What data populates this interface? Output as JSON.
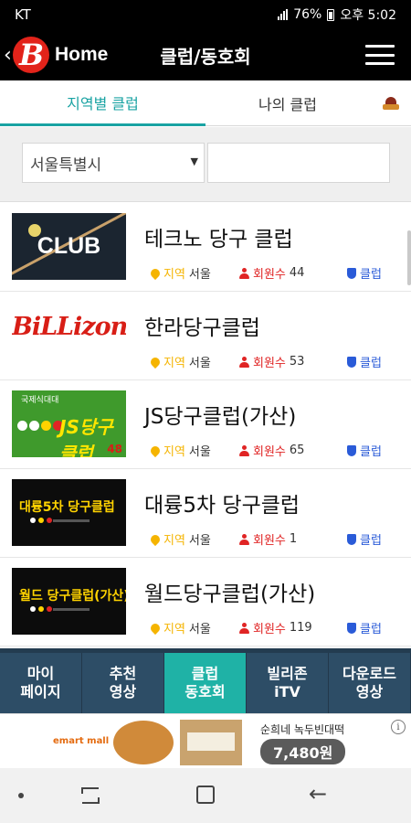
{
  "status_bar": {
    "carrier": "KT",
    "battery": "76%",
    "time": "오후 5:02"
  },
  "header": {
    "home_label": "Home",
    "title": "클럽/동호회",
    "logo_letter": "B"
  },
  "tabs": [
    {
      "label": "지역별 클럽",
      "active": true
    },
    {
      "label": "나의 클럽",
      "active": false
    }
  ],
  "filter": {
    "region_value": "서울특별시",
    "search_value": ""
  },
  "meta_labels": {
    "region": "지역",
    "members": "회원수",
    "club": "클럽"
  },
  "clubs": [
    {
      "name": "테크노 당구 클럽",
      "region": "서울",
      "members": "44",
      "thumb_text": "CLUB"
    },
    {
      "name": "한라당구클럽",
      "region": "서울",
      "members": "53",
      "thumb_text": "BiLLizone"
    },
    {
      "name": "JS당구클럽(가산)",
      "region": "서울",
      "members": "65",
      "thumb_text": "JS당구클럽",
      "thumb_top": "국제식대대",
      "thumb_num": "48"
    },
    {
      "name": "대륭5차 당구클럽",
      "region": "서울",
      "members": "1",
      "thumb_text": "대륭5차 당구클럽"
    },
    {
      "name": "월드당구클럽(가산)",
      "region": "서울",
      "members": "119",
      "thumb_text": "월드 당구클럽(가산)"
    }
  ],
  "bottom_nav": [
    {
      "label": "마이\n페이지",
      "active": false
    },
    {
      "label": "추천\n영상",
      "active": false
    },
    {
      "label": "클럽\n동호회",
      "active": true
    },
    {
      "label": "빌리존\niTV",
      "active": false
    },
    {
      "label": "다운로드\n영상",
      "active": false
    }
  ],
  "ad": {
    "brand": "emart mall",
    "headline": "순희네 녹두빈대떡",
    "price": "7,480원",
    "info": "i"
  },
  "colors": {
    "accent": "#1aa3a3",
    "nav_bg": "#2d4d66",
    "nav_active": "#1fb2a6",
    "brand_red": "#e2231a"
  }
}
